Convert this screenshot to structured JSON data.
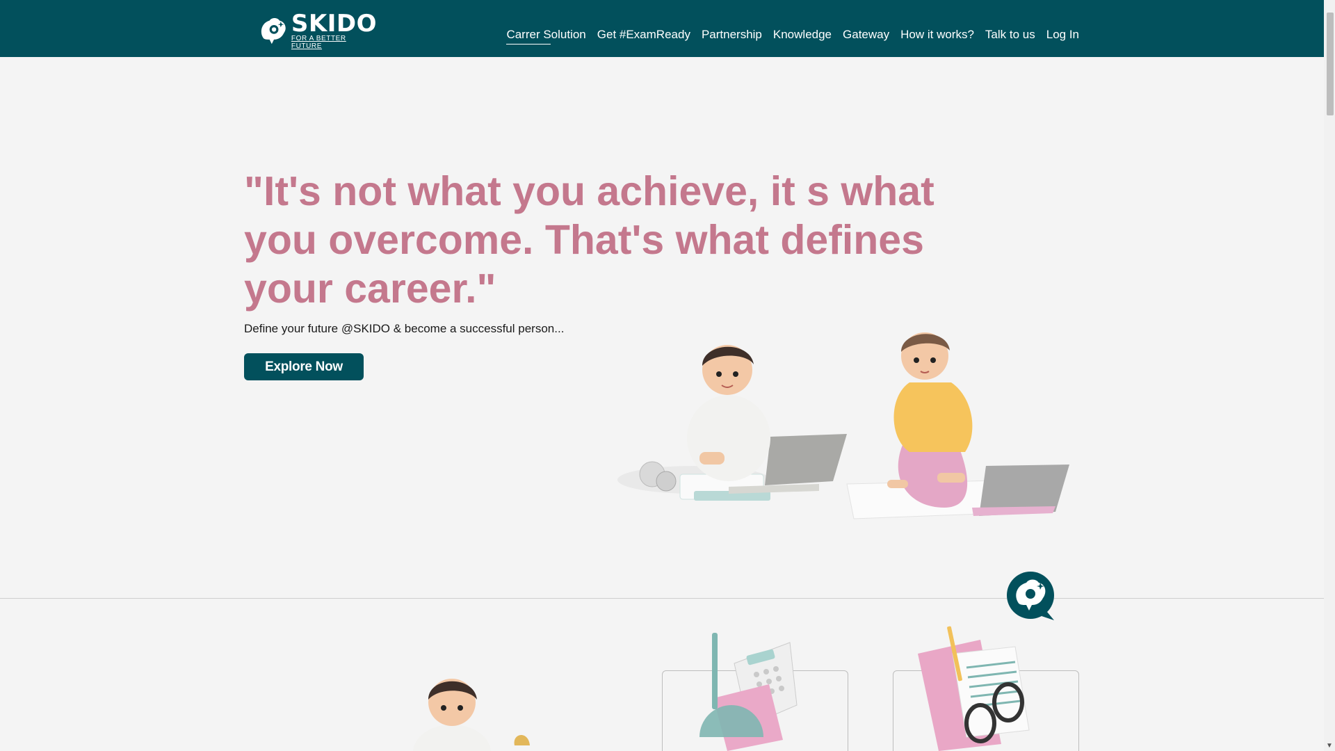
{
  "brand": {
    "name": "SKIDO",
    "tagline": "FOR A BETTER FUTURE",
    "logo_icon": "skido-head-logo-icon"
  },
  "nav": {
    "items": [
      {
        "label": "Carrer Solution",
        "active": true
      },
      {
        "label": "Get #ExamReady"
      },
      {
        "label": "Partnership"
      },
      {
        "label": "Knowledge"
      },
      {
        "label": "Gateway"
      },
      {
        "label": "How it works?"
      },
      {
        "label": "Talk to us"
      },
      {
        "label": "Log In"
      }
    ]
  },
  "hero": {
    "quote": "\"It's not what you achieve, it s what you overcome. That's what defines your career.\"",
    "subtitle": "Define your future @SKIDO & become a successful person...",
    "cta_label": "Explore Now"
  },
  "colors": {
    "primary": "#02505c",
    "quote_pink": "#c4788d",
    "background": "#f4f4f4"
  }
}
